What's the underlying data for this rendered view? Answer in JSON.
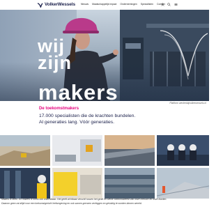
{
  "header": {
    "logo_text": "VolkerWessels",
    "badge_count": "",
    "nav": [
      "Nieuws",
      "Maatschappelijk impact",
      "Ondernemingen",
      "Specialisten",
      "Contact"
    ]
  },
  "hero": {
    "line1": "wij",
    "line2": "zijn",
    "line3": "makers",
    "credit": "Platform werkenbijvolkerwessels.nl"
  },
  "intro": {
    "title": "De toekomstmakers",
    "line1": "17.000 specialisten die de krachten bundelen.",
    "line2": "Al generaties lang. Vóór generaties."
  },
  "footer": {
    "line1": "Makers is doen. En makers is soms ook onzichtbaar. Het geeft zichtbaar verschil tussen het grote en kleine toekomstbeeld van onze mensen en onze klanten.",
    "line2": "Daarom geen rat altijd voor een toekomstgericht leefomgeving en ook samen grenzen verleggen en gelukkig te worden binnen wereld."
  },
  "colors": {
    "accent": "#e5007d",
    "brand": "#1a1f4a"
  },
  "icons": [
    "logo-mark-icon",
    "user-icon",
    "search-icon",
    "menu-icon"
  ]
}
